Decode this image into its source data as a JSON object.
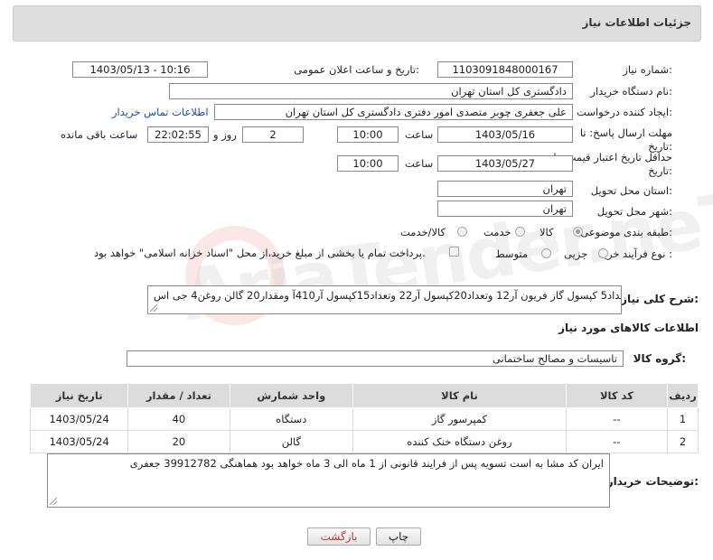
{
  "header": {
    "title": "جزئیات اطلاعات نیاز"
  },
  "need_number": {
    "label": "شماره نیاز:",
    "value": "1103091848000167"
  },
  "announce": {
    "label": "تاریخ و ساعت اعلان عمومی:",
    "value": "1403/05/13 - 10:16"
  },
  "buyer": {
    "label": "نام دستگاه خریدار:",
    "value": "دادگستری کل استان تهران"
  },
  "creator": {
    "label": "ایجاد کننده درخواست:",
    "value": "علی جعفری چوبر متصدی امور دفتری دادگستری کل استان تهران",
    "contact_link": "اطلاعات تماس خریدار"
  },
  "deadline": {
    "label_line1": "مهلت ارسال پاسخ: تا",
    "label_line2": "تاریخ:",
    "date": "1403/05/16",
    "time_label": "ساعت",
    "time": "10:00",
    "days": "2",
    "days_label": "روز و",
    "remaining": "22:02:55",
    "remaining_label": "ساعت باقی مانده"
  },
  "validity": {
    "label_line1": "حداقل تاریخ اعتبار قیمت: تا",
    "label_line2": "تاریخ:",
    "date": "1403/05/27",
    "time_label": "ساعت",
    "time": "10:00"
  },
  "province": {
    "label": "استان محل تحویل:",
    "value": "تهران"
  },
  "city": {
    "label": "شهر محل تحویل:",
    "value": "تهران"
  },
  "category": {
    "label": "طبقه بندی موضوعی:",
    "options": [
      "کالا",
      "خدمت",
      "کالا/خدمت"
    ],
    "selected": "کالا"
  },
  "process": {
    "label": "نوع فرآیند خرید :",
    "options": [
      "جزیی",
      "متوسط"
    ],
    "payment_note": "پرداخت تمام یا بخشی از مبلغ خرید،از محل \"اسناد خزانه اسلامی\" خواهد بود."
  },
  "description": {
    "label": "شرح کلی نیاز:",
    "value": "تعداد5 کپسول گاز فریون آر12 وتعداد20کپسول آر22 وتعداد15کپسول آر410آ ومقدار20 گالن روغن4 جی اس"
  },
  "goods_info_title": "اطلاعات کالاهای مورد نیاز",
  "goods_group": {
    "label": "گروه کالا:",
    "value": "تاسیسات و مصالح ساختمانی"
  },
  "table": {
    "headers": [
      "ردیف",
      "کد کالا",
      "نام کالا",
      "واحد شمارش",
      "تعداد / مقدار",
      "تاریخ نیاز"
    ],
    "rows": [
      [
        "1",
        "--",
        "کمپرسور گاز",
        "دستگاه",
        "40",
        "1403/05/24"
      ],
      [
        "2",
        "--",
        "روغن دستگاه خنک کننده",
        "گالن",
        "20",
        "1403/05/24"
      ]
    ]
  },
  "buyer_notes": {
    "label": "توضیحات خریدار:",
    "value": "ایران کد مشا به است تسویه  پس از فرایند قانونی از 1 ماه الی 3 ماه خواهد بود هماهنگی 39912782 جعفری"
  },
  "buttons": {
    "print": "چاپ",
    "back": "بازگشت"
  },
  "watermark": "AriaTender.neT",
  "colors": {
    "header_bg": "#dedede",
    "link": "#1a4fa0",
    "back_text": "#c0392b"
  }
}
